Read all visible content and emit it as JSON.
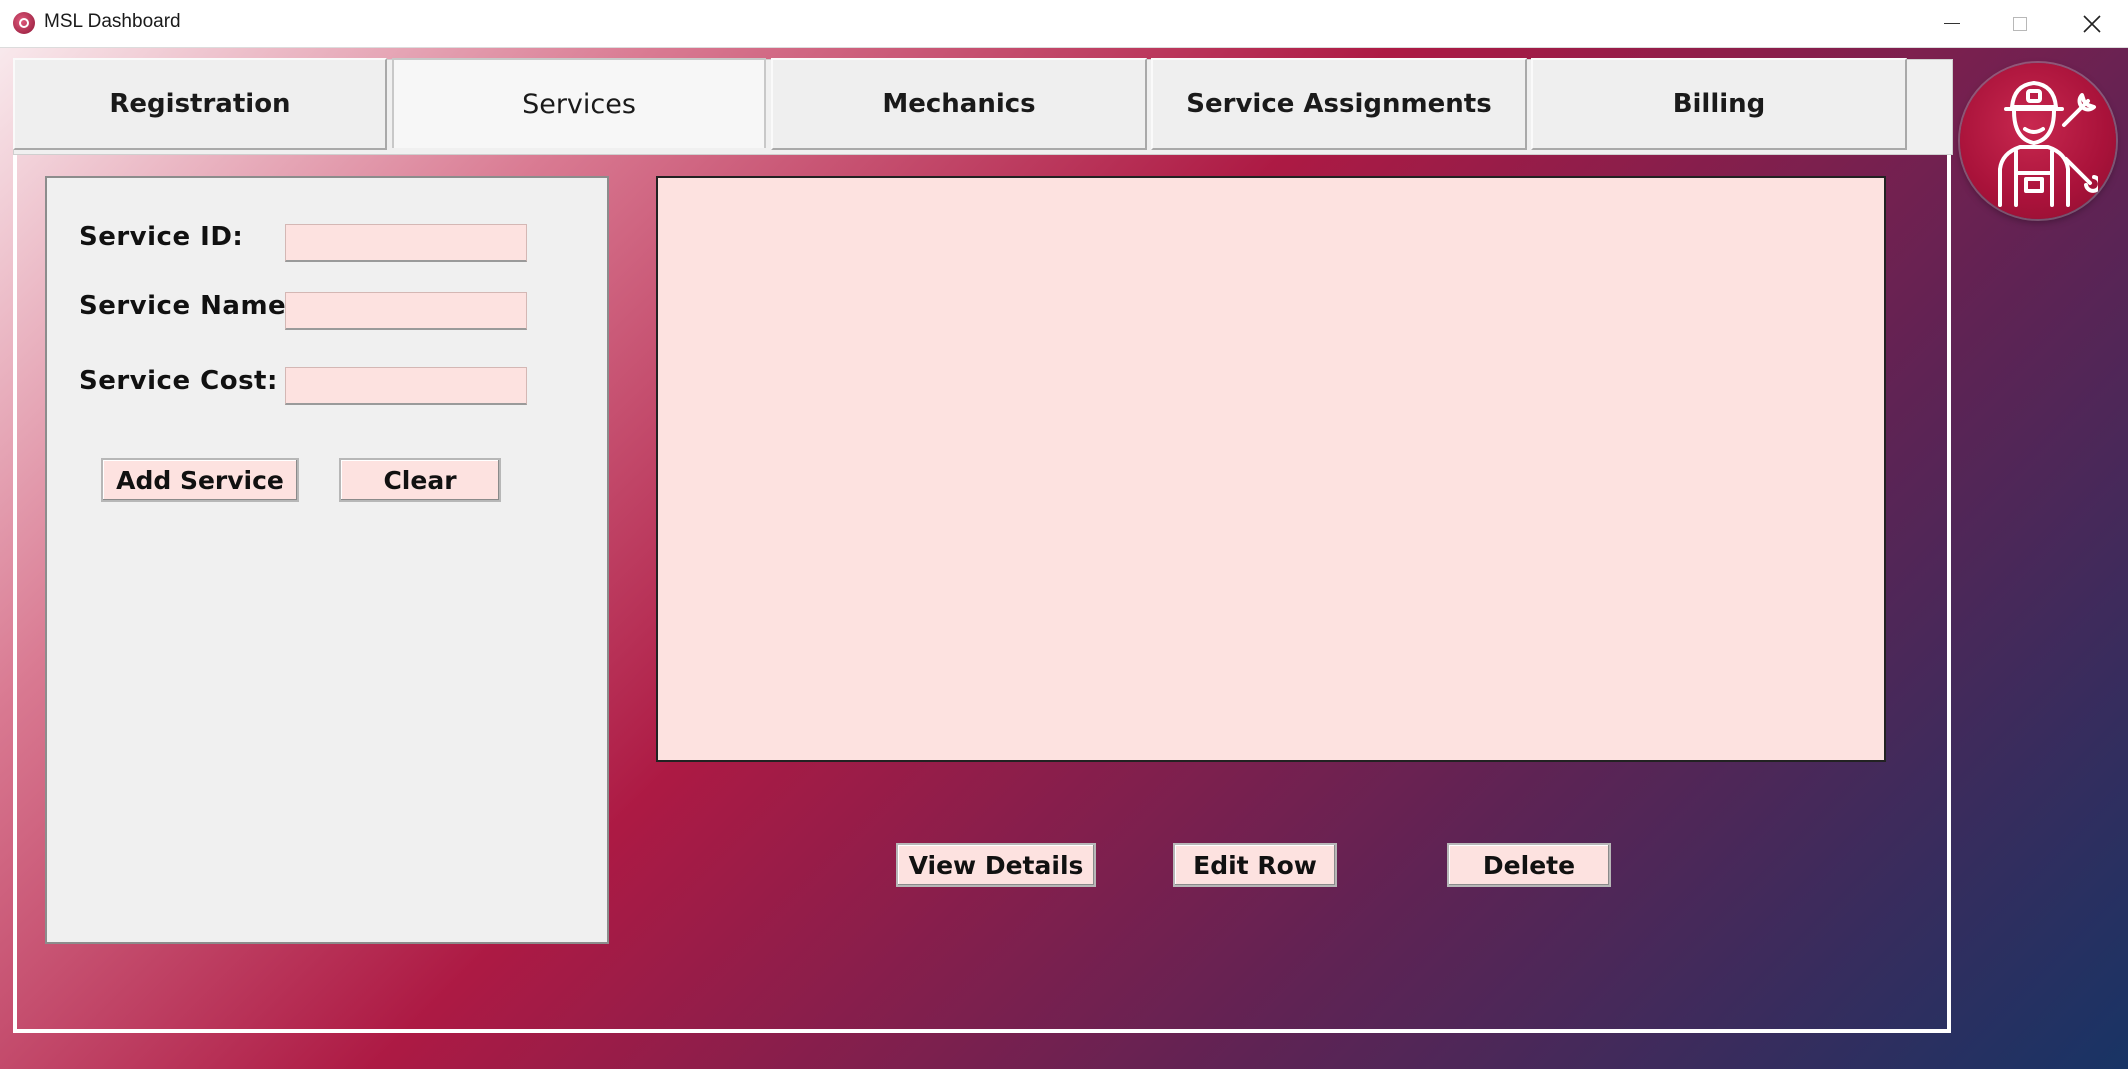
{
  "window": {
    "title": "MSL Dashboard",
    "icons": {
      "app": "app-logo-icon",
      "minimize": "minimize-icon",
      "maximize": "maximize-icon",
      "close": "close-icon"
    }
  },
  "tabs": [
    {
      "label": "Registration",
      "active": false
    },
    {
      "label": "Services",
      "active": true
    },
    {
      "label": "Mechanics",
      "active": false
    },
    {
      "label": "Service Assignments",
      "active": false
    },
    {
      "label": "Billing",
      "active": false
    }
  ],
  "form": {
    "service_id_label": "Service ID:",
    "service_id_value": "",
    "service_name_label": "Service Name:",
    "service_name_value": "",
    "service_cost_label": "Service Cost:",
    "service_cost_value": "",
    "add_label": "Add Service",
    "clear_label": "Clear"
  },
  "actions": {
    "view_label": "View Details",
    "edit_label": "Edit Row",
    "delete_label": "Delete"
  },
  "logo": {
    "icon": "mechanic-icon"
  },
  "colors": {
    "input_bg": "#fde2e0",
    "panel_bg": "#f0f0f0",
    "gradient_start": "#fbf1f3",
    "gradient_mid": "#ad1a44",
    "gradient_end": "#183465",
    "logo_bg": "#a9123a"
  }
}
